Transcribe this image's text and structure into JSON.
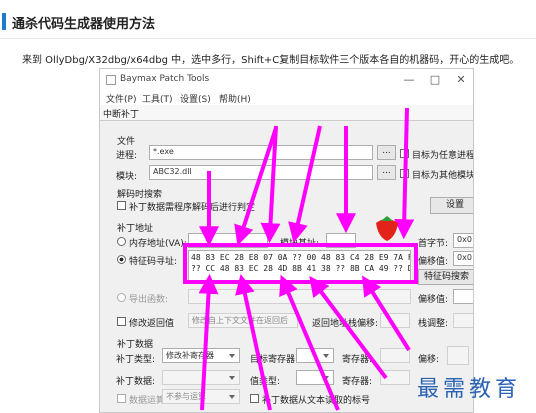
{
  "article": {
    "title": "通杀代码生成器使用方法",
    "text": "来到 OllyDbg/X32dbg/x64dbg 中，选中多行，Shift+C复制目标软件三个版本各自的机器码，开心的生成吧。"
  },
  "window": {
    "title": "Baymax Patch Tools",
    "controls": [
      "—",
      "□",
      "✕"
    ],
    "menu": [
      "文件(P)",
      "工具(T)",
      "设置(S)",
      "帮助(H)"
    ],
    "tab": "中断补丁"
  },
  "file_section": {
    "title": "文件",
    "process_label": "进程:",
    "process_value": "*.exe",
    "module_label": "模块:",
    "module_value": "ABC32.dll",
    "browse": "...",
    "target_any_process": "目标为任意进程",
    "target_other_module": "目标为其他模块"
  },
  "decode_section": {
    "title": "解码时搜索",
    "checkbox": "补丁数据需程序解码后进行判定",
    "settings_button": "设置"
  },
  "address_section": {
    "title": "补丁地址",
    "memory_address": "内存地址(VA):",
    "module_base": "模块基址:",
    "first_byte": "首字节:",
    "first_byte_value": "0x0",
    "offset": "偏移值:",
    "offset_value": "0x0",
    "signature_address": "特征码寻址:",
    "signature_lines": [
      "48 83 EC 28 E8 07 0A ?? 00 48 83 C4 28 E9 7A FE FF FF",
      "?? CC 48 83 EC 28 4D 8B 41 38 ?? 8B CA 49 ?? D1"
    ],
    "signature_search": "特征码搜索",
    "export_function": "导出函数:",
    "offset2": "偏移值:"
  },
  "return_section": {
    "modify_return": "修改返回值",
    "hint": "修改自上下文文件在返回后",
    "return_offset": "返回地址栈偏移:",
    "stack_adjust": "栈调整:"
  },
  "patch_data": {
    "title": "补丁数据",
    "type_label": "补丁类型:",
    "type_value": "修改补寄存器",
    "target_register": "目标寄存器:",
    "register": "寄存器:",
    "offset": "偏移:",
    "patch_data_label": "补丁数据:",
    "value_type": "值类型:",
    "register2": "寄存器:",
    "data_operation": "数据运算",
    "no_operation": "不参与运算",
    "read_from_text": "补丁数据从文本读取的标号"
  },
  "watermark": "最需教育",
  "colors": {
    "arrow": "#ff00ff",
    "accent": "#1f7bd0",
    "watermark": "#2a62b4"
  }
}
